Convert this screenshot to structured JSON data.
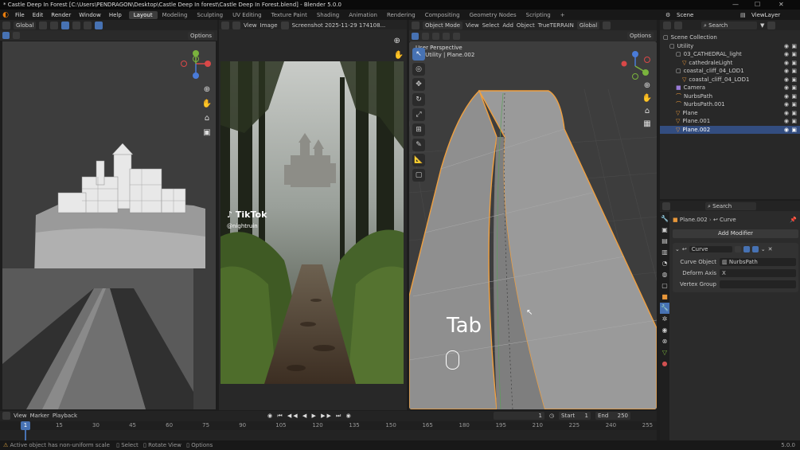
{
  "window": {
    "title": "* Castle Deep In Forest [C:\\Users\\PENDRAGON\\Desktop\\Castle Deep In forest\\Castle Deep In Forest.blend] - Blender 5.0.0",
    "minimize": "—",
    "maximize": "☐",
    "close": "✕"
  },
  "menu": {
    "items": [
      "File",
      "Edit",
      "Render",
      "Window",
      "Help"
    ],
    "workspaces": [
      "Layout",
      "Modeling",
      "Sculpting",
      "UV Editing",
      "Texture Paint",
      "Shading",
      "Animation",
      "Rendering",
      "Compositing",
      "Geometry Nodes",
      "Scripting"
    ],
    "active_workspace": "Layout",
    "add_workspace": "+",
    "scene_label": "Scene",
    "viewlayer_label": "ViewLayer"
  },
  "left_viewport": {
    "orientation": "Global",
    "options": "Options"
  },
  "image_editor": {
    "view": "View",
    "image_menu": "Image",
    "image_name": "Screenshot 2025-11-29 174108...",
    "watermark": "TikTok",
    "handle": "@nightruin"
  },
  "right_viewport": {
    "mode": "Object Mode",
    "menus": [
      "View",
      "Select",
      "Add",
      "Object",
      "TrueTERRAIN"
    ],
    "orientation": "Global",
    "options": "Options",
    "perspective_label": "User Perspective",
    "object_label": "(1) Utility | Plane.002",
    "key_overlay": "Tab"
  },
  "outliner": {
    "search_placeholder": "Search",
    "rows": [
      {
        "name": "Scene Collection",
        "indent": 0,
        "type": "collection"
      },
      {
        "name": "Utility",
        "indent": 1,
        "type": "collection"
      },
      {
        "name": "03_CATHEDRAL_light",
        "indent": 2,
        "type": "collection"
      },
      {
        "name": "cathedraleLight",
        "indent": 3,
        "type": "mesh"
      },
      {
        "name": "coastal_cliff_04_LOD1",
        "indent": 2,
        "type": "collection"
      },
      {
        "name": "coastal_cliff_04_LOD1",
        "indent": 3,
        "type": "mesh"
      },
      {
        "name": "Camera",
        "indent": 2,
        "type": "camera"
      },
      {
        "name": "NurbsPath",
        "indent": 2,
        "type": "curve"
      },
      {
        "name": "NurbsPath.001",
        "indent": 2,
        "type": "curve"
      },
      {
        "name": "Plane",
        "indent": 2,
        "type": "mesh"
      },
      {
        "name": "Plane.001",
        "indent": 2,
        "type": "mesh"
      },
      {
        "name": "Plane.002",
        "indent": 2,
        "type": "mesh",
        "selected": true
      }
    ]
  },
  "properties": {
    "search_placeholder": "Search",
    "breadcrumb_object": "Plane.002",
    "breadcrumb_modifier": "Curve",
    "add_modifier": "Add Modifier",
    "modifier_name": "Curve",
    "curve_object_label": "Curve Object",
    "curve_object_value": "NurbsPath",
    "deform_axis_label": "Deform Axis",
    "deform_axis_value": "X",
    "vertex_group_label": "Vertex Group"
  },
  "timeline": {
    "view": "View",
    "marker": "Marker",
    "playback": "Playback",
    "current_frame": "1",
    "start_label": "Start",
    "start_value": "1",
    "end_label": "End",
    "end_value": "250",
    "ruler_current": "1",
    "ruler": [
      "15",
      "30",
      "45",
      "60",
      "75",
      "90",
      "105",
      "120",
      "135",
      "150",
      "165",
      "180",
      "195",
      "210",
      "225",
      "240",
      "255"
    ]
  },
  "status": {
    "message": "Active object has non-uniform scale",
    "select": "Select",
    "rotate": "Rotate View",
    "options": "Options",
    "version": "5.0.0"
  },
  "colors": {
    "accent": "#4772b3",
    "selection": "#334d80",
    "highlight_orange": "#f0a040"
  }
}
